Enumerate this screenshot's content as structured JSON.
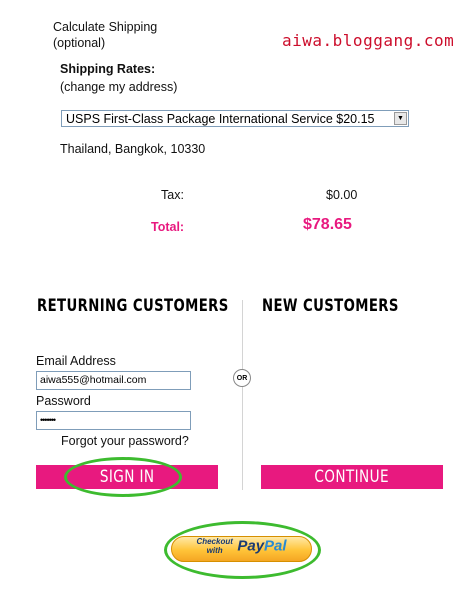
{
  "shipping": {
    "title": "Calculate Shipping",
    "optional": "(optional)",
    "rates_label": "Shipping Rates:",
    "change_address": "(change my address)",
    "selected_rate": "USPS First-Class Package International Service $20.15",
    "address": "Thailand, Bangkok, 10330"
  },
  "watermark": "aiwa.bloggang.com",
  "totals": {
    "tax_label": "Tax:",
    "tax_value": "$0.00",
    "total_label": "Total:",
    "total_value": "$78.65"
  },
  "returning": {
    "heading": "RETURNING CUSTOMERS",
    "email_label": "Email Address",
    "email_value": "aiwa555@hotmail.com",
    "password_label": "Password",
    "password_value": "•••••••",
    "forgot": "Forgot your password?",
    "sign_in": "SIGN IN"
  },
  "or_label": "OR",
  "new_customers": {
    "heading": "NEW CUSTOMERS",
    "continue": "CONTINUE"
  },
  "paypal": {
    "checkout": "Checkout",
    "with": "with",
    "pay": "Pay",
    "pal": "Pal"
  },
  "colors": {
    "accent_pink": "#e8197f",
    "highlight_green": "#3dbb2f",
    "watermark_red": "#cc0d2b"
  }
}
